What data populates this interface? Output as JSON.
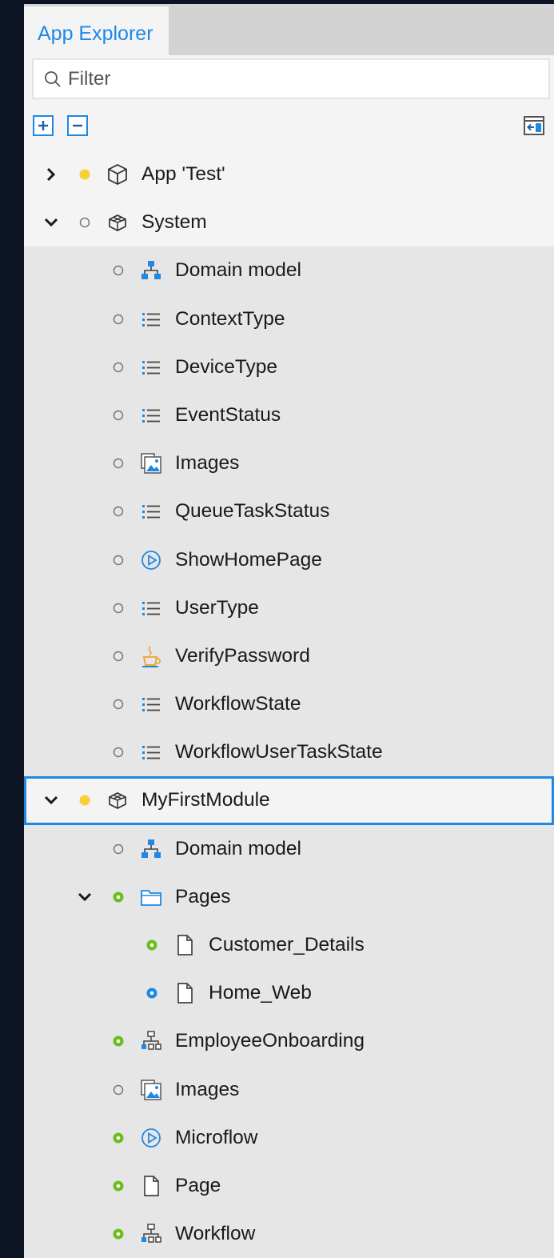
{
  "panel": {
    "tab_label": "App Explorer",
    "filter_placeholder": "Filter"
  },
  "colors": {
    "accent": "#1e88e5",
    "status_yellow": "#f7d038",
    "status_green": "#6abf1a",
    "status_blue": "#1e88e5"
  },
  "tree": [
    {
      "label": "App 'Test'",
      "level": 0,
      "chevron": "right",
      "status": "yellow",
      "icon": "cube-icon",
      "bg": "light"
    },
    {
      "label": "System",
      "level": 0,
      "chevron": "down",
      "status": "empty",
      "icon": "module-icon",
      "bg": "light"
    },
    {
      "label": "Domain model",
      "level": 1,
      "status": "empty",
      "icon": "domain-model-icon"
    },
    {
      "label": "ContextType",
      "level": 1,
      "status": "empty",
      "icon": "enumeration-icon"
    },
    {
      "label": "DeviceType",
      "level": 1,
      "status": "empty",
      "icon": "enumeration-icon"
    },
    {
      "label": "EventStatus",
      "level": 1,
      "status": "empty",
      "icon": "enumeration-icon"
    },
    {
      "label": "Images",
      "level": 1,
      "status": "empty",
      "icon": "images-icon"
    },
    {
      "label": "QueueTaskStatus",
      "level": 1,
      "status": "empty",
      "icon": "enumeration-icon"
    },
    {
      "label": "ShowHomePage",
      "level": 1,
      "status": "empty",
      "icon": "microflow-icon"
    },
    {
      "label": "UserType",
      "level": 1,
      "status": "empty",
      "icon": "enumeration-icon"
    },
    {
      "label": "VerifyPassword",
      "level": 1,
      "status": "empty",
      "icon": "java-action-icon"
    },
    {
      "label": "WorkflowState",
      "level": 1,
      "status": "empty",
      "icon": "enumeration-icon"
    },
    {
      "label": "WorkflowUserTaskState",
      "level": 1,
      "status": "empty",
      "icon": "enumeration-icon"
    },
    {
      "label": "MyFirstModule",
      "level": 0,
      "chevron": "down",
      "status": "yellow",
      "icon": "module-icon",
      "bg": "selected"
    },
    {
      "label": "Domain model",
      "level": 1,
      "status": "empty",
      "icon": "domain-model-icon"
    },
    {
      "label": "Pages",
      "level": 1,
      "chevron": "down",
      "status": "green",
      "icon": "folder-icon"
    },
    {
      "label": "Customer_Details",
      "level": 2,
      "status": "green",
      "icon": "page-icon"
    },
    {
      "label": "Home_Web",
      "level": 2,
      "status": "blue",
      "icon": "page-icon"
    },
    {
      "label": "EmployeeOnboarding",
      "level": 1,
      "status": "green",
      "icon": "workflow-icon"
    },
    {
      "label": "Images",
      "level": 1,
      "status": "empty",
      "icon": "images-icon"
    },
    {
      "label": "Microflow",
      "level": 1,
      "status": "green",
      "icon": "microflow-icon"
    },
    {
      "label": "Page",
      "level": 1,
      "status": "green",
      "icon": "page-icon"
    },
    {
      "label": "Workflow",
      "level": 1,
      "status": "green",
      "icon": "workflow-icon"
    }
  ]
}
